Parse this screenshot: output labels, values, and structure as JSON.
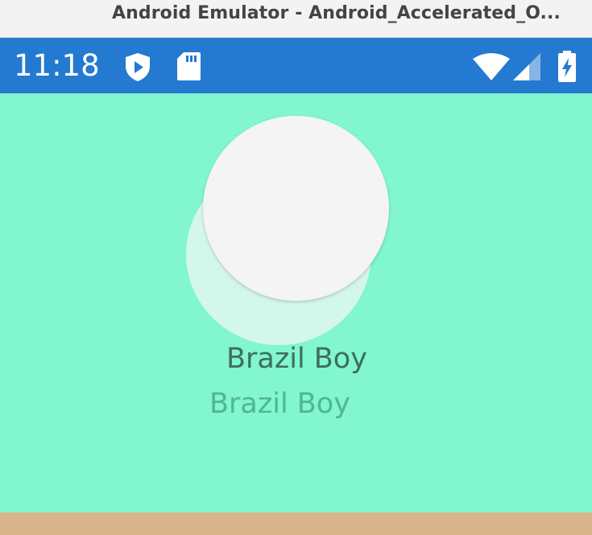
{
  "window": {
    "title": "Android Emulator - Android_Accelerated_O..."
  },
  "status_bar": {
    "time": "11:18",
    "left_icons": [
      "shield-play-icon",
      "sd-card-icon"
    ],
    "right_icons": [
      "wifi-icon",
      "cellular-signal-icon",
      "battery-charging-icon"
    ],
    "background": "#2479d0"
  },
  "app": {
    "background": "#81f6cf",
    "card_front": {
      "name": "Brazil Boy"
    },
    "card_back": {
      "name": "Brazil Boy"
    }
  },
  "colors": {
    "front_name": "#3e6e5d",
    "back_name": "#52b594",
    "bottom_strip": "#d8b48a"
  }
}
